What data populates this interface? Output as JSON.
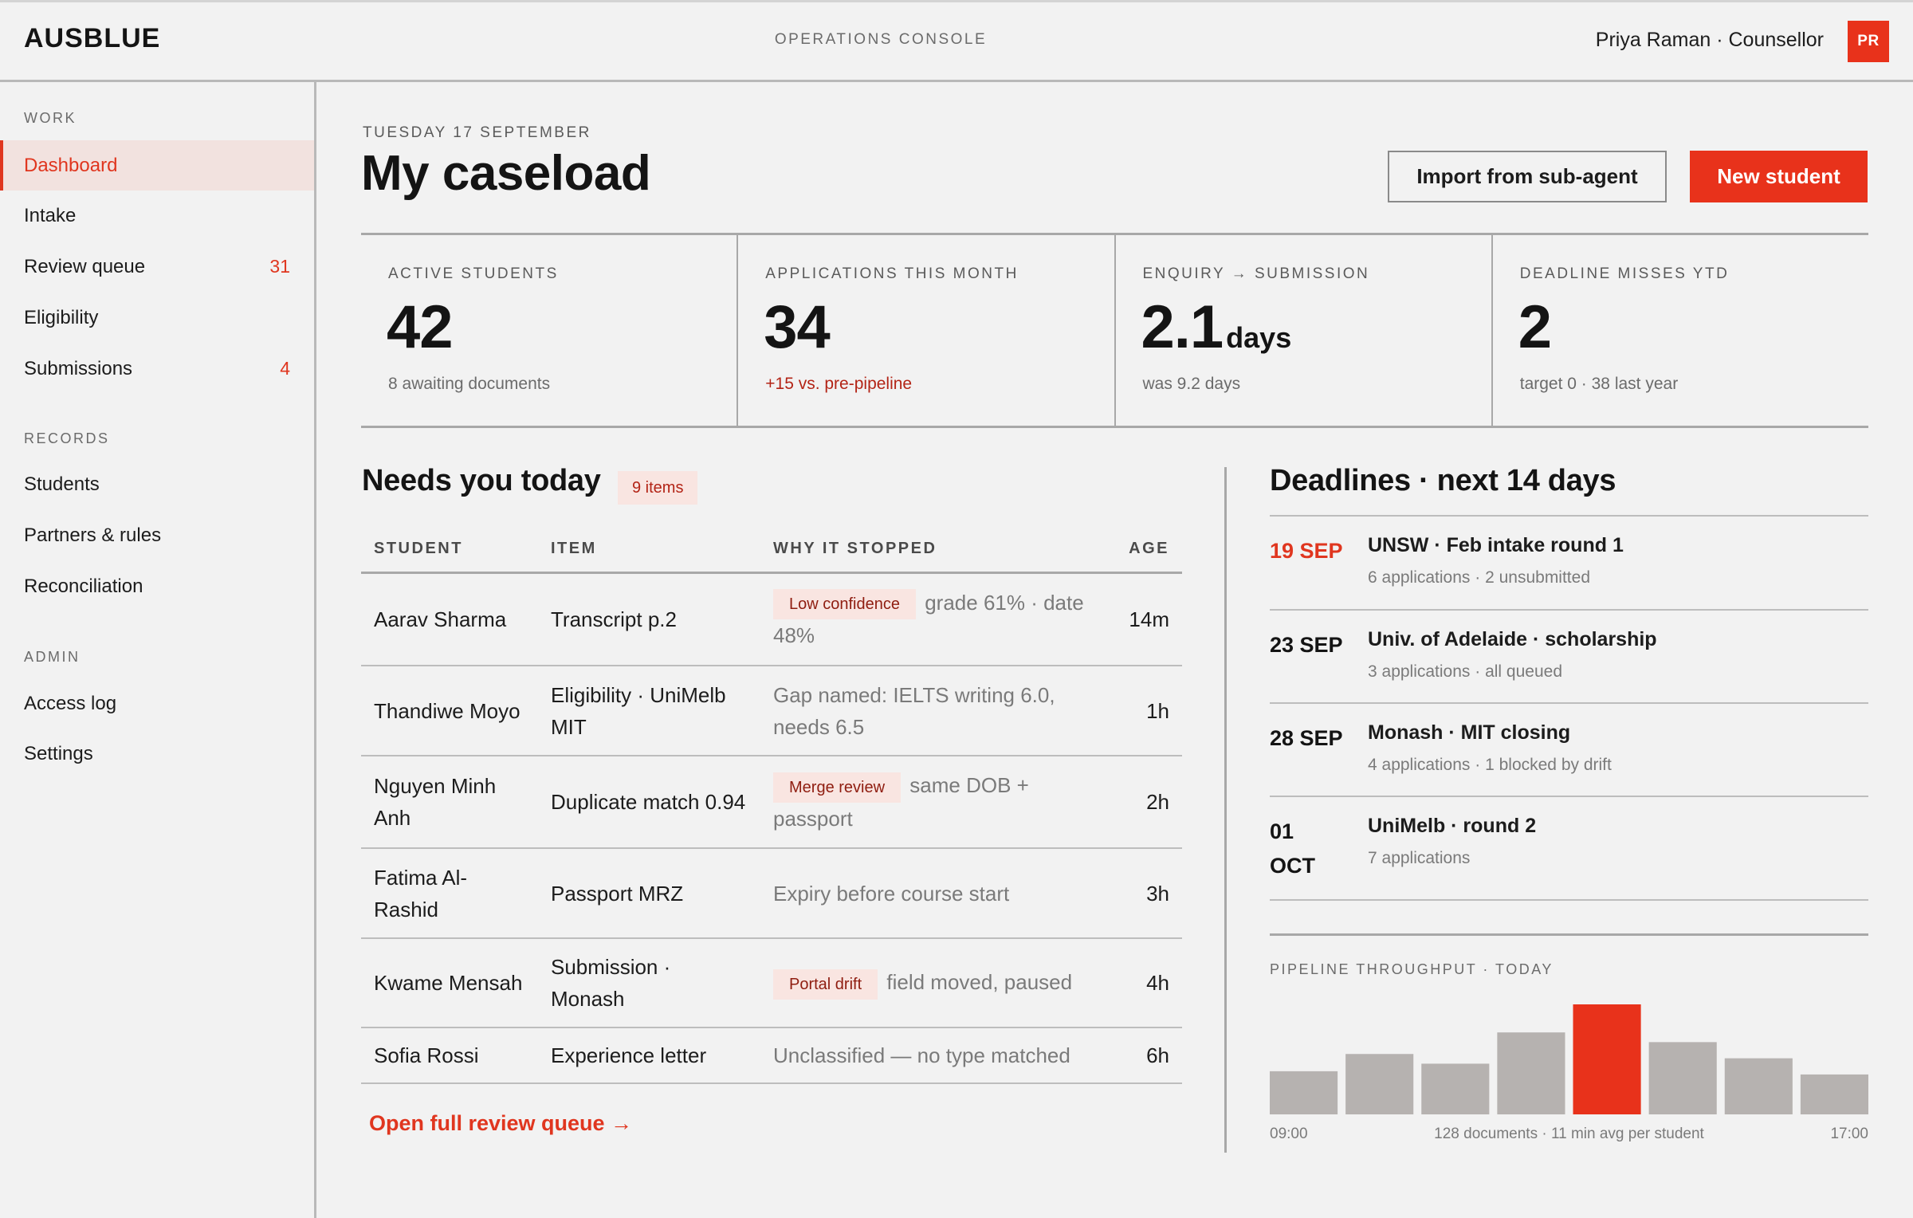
{
  "header": {
    "brand": "AUSBLUE",
    "console_label": "OPERATIONS CONSOLE",
    "user": "Priya Raman · Counsellor",
    "avatar_initials": "PR"
  },
  "sidebar": {
    "sections": [
      {
        "title": "WORK",
        "items": [
          {
            "label": "Dashboard",
            "count": "",
            "active": true
          },
          {
            "label": "Intake",
            "count": ""
          },
          {
            "label": "Review queue",
            "count": "31"
          },
          {
            "label": "Eligibility",
            "count": ""
          },
          {
            "label": "Submissions",
            "count": "4"
          }
        ]
      },
      {
        "title": "RECORDS",
        "items": [
          {
            "label": "Students",
            "count": ""
          },
          {
            "label": "Partners & rules",
            "count": ""
          },
          {
            "label": "Reconciliation",
            "count": ""
          }
        ]
      },
      {
        "title": "ADMIN",
        "items": [
          {
            "label": "Access log",
            "count": ""
          },
          {
            "label": "Settings",
            "count": ""
          }
        ]
      }
    ]
  },
  "page": {
    "date": "TUESDAY 17 SEPTEMBER",
    "title": "My caseload",
    "import_button": "Import from sub-agent",
    "new_button": "New student"
  },
  "kpis": [
    {
      "label": "ACTIVE STUDENTS",
      "value": "42",
      "unit": "",
      "sub": "8 awaiting documents"
    },
    {
      "label": "APPLICATIONS THIS MONTH",
      "value": "34",
      "unit": "",
      "sub": "+15 vs. pre-pipeline"
    },
    {
      "label": "ENQUIRY → SUBMISSION",
      "value": "2.1",
      "unit": "days",
      "sub": "was 9.2 days"
    },
    {
      "label": "DEADLINE MISSES YTD",
      "value": "2",
      "unit": "",
      "sub": "target 0 · 38 last year"
    }
  ],
  "needs": {
    "title": "Needs you today",
    "badge": "9 items",
    "columns": {
      "student": "STUDENT",
      "item": "ITEM",
      "why": "WHY IT STOPPED",
      "age": "AGE"
    },
    "rows": [
      {
        "student": "Aarav Sharma",
        "item": "Transcript p.2",
        "tag": "Low confidence",
        "why": "grade 61% · date 48%",
        "age": "14m"
      },
      {
        "student": "Thandiwe Moyo",
        "item": "Eligibility · UniMelb MIT",
        "tag": "",
        "why": "Gap named: IELTS writing 6.0, needs 6.5",
        "age": "1h"
      },
      {
        "student": "Nguyen Minh Anh",
        "item": "Duplicate match 0.94",
        "tag": "Merge review",
        "why": "same DOB + passport",
        "age": "2h"
      },
      {
        "student": "Fatima Al-Rashid",
        "item": "Passport MRZ",
        "tag": "",
        "why": "Expiry before course start",
        "age": "3h"
      },
      {
        "student": "Kwame Mensah",
        "item": "Submission · Monash",
        "tag": "Portal drift",
        "why": "field moved, paused",
        "age": "4h"
      },
      {
        "student": "Sofia Rossi",
        "item": "Experience letter",
        "tag": "",
        "why": "Unclassified — no type matched",
        "age": "6h"
      }
    ],
    "open_link": "Open full review queue →"
  },
  "deadlines": {
    "title": "Deadlines · next 14 days",
    "items": [
      {
        "date": "19 SEP",
        "urgent": true,
        "name": "UNSW · Feb intake round 1",
        "meta": "6 applications · 2 unsubmitted"
      },
      {
        "date": "23 SEP",
        "urgent": false,
        "name": "Univ. of Adelaide · scholarship",
        "meta": "3 applications · all queued"
      },
      {
        "date": "28 SEP",
        "urgent": false,
        "name": "Monash · MIT closing",
        "meta": "4 applications · 1 blocked by drift"
      },
      {
        "date": "01 OCT",
        "urgent": false,
        "name": "UniMelb · round 2",
        "meta": "7 applications"
      }
    ]
  },
  "throughput": {
    "label": "PIPELINE THROUGHPUT · TODAY",
    "start": "09:00",
    "summary": "128 documents · 11 min avg per student",
    "end": "17:00",
    "colors": {
      "bar": "#b6b2b0",
      "highlight": "#e8321b"
    }
  },
  "chart_data": {
    "type": "bar",
    "title": "PIPELINE THROUGHPUT · TODAY",
    "values": [
      40,
      56,
      47,
      76,
      102,
      67,
      52,
      37
    ],
    "highlight_index": 4,
    "x_start": "09:00",
    "x_end": "17:00"
  }
}
